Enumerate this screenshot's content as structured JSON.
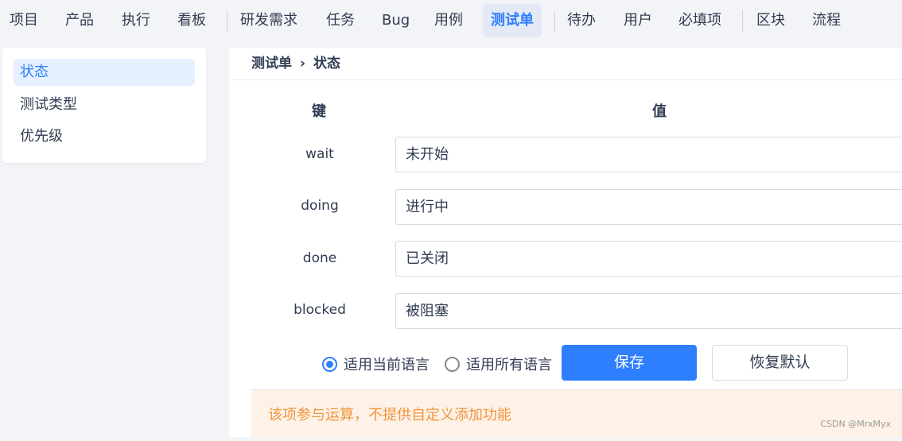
{
  "nav": {
    "items": [
      "项目",
      "产品",
      "执行",
      "看板",
      "研发需求",
      "任务",
      "Bug",
      "用例",
      "测试单",
      "待办",
      "用户",
      "必填项",
      "区块",
      "流程"
    ],
    "active": "测试单"
  },
  "sidebar": {
    "items": [
      "状态",
      "测试类型",
      "优先级"
    ],
    "active": "状态"
  },
  "breadcrumb": {
    "parent": "测试单",
    "sep": "›",
    "current": "状态"
  },
  "table": {
    "key_header": "键",
    "value_header": "值",
    "rows": [
      {
        "key": "wait",
        "value": "未开始"
      },
      {
        "key": "doing",
        "value": "进行中"
      },
      {
        "key": "done",
        "value": "已关闭"
      },
      {
        "key": "blocked",
        "value": "被阻塞"
      }
    ]
  },
  "lang_options": {
    "current": "适用当前语言",
    "all": "适用所有语言",
    "selected": "current"
  },
  "buttons": {
    "save": "保存",
    "reset": "恢复默认"
  },
  "notice": "该项参与运算，不提供自定义添加功能",
  "watermark": "CSDN @MrxMyx",
  "colors": {
    "accent": "#2e7fff",
    "notice_text": "#f0953a",
    "notice_bg": "#fef2e8"
  }
}
